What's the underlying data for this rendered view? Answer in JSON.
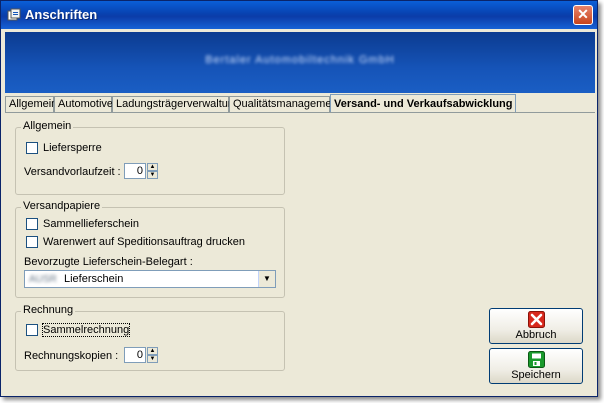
{
  "window": {
    "title": "Anschriften",
    "close_glyph": "✕"
  },
  "banner": {
    "company": "Bertaler Automobiltechnik GmbH"
  },
  "tabs": [
    {
      "label": "Allgemein",
      "active": false
    },
    {
      "label": "Automotive",
      "active": false
    },
    {
      "label": "Ladungsträgerverwaltung",
      "active": false
    },
    {
      "label": "Qualitätsmanagement",
      "active": false
    },
    {
      "label": "Versand- und Verkaufsabwicklung",
      "active": true
    }
  ],
  "allgemein": {
    "title": "Allgemein",
    "liefersperre": {
      "label": "Liefersperre",
      "checked": false
    },
    "versandvorlaufzeit": {
      "label": "Versandvorlaufzeit :",
      "value": "0"
    }
  },
  "versandpapiere": {
    "title": "Versandpapiere",
    "sammellieferschein": {
      "label": "Sammellieferschein",
      "checked": false
    },
    "warenwert": {
      "label": "Warenwert auf Speditionsauftrag drucken",
      "checked": false
    },
    "belegart": {
      "label": "Bevorzugte Lieferschein-Belegart :",
      "prefix": "AUSR",
      "value": "Lieferschein"
    }
  },
  "rechnung": {
    "title": "Rechnung",
    "sammelrechnung": {
      "label": "Sammelrechnung",
      "checked": false
    },
    "kopien": {
      "label": "Rechnungskopien :",
      "value": "0"
    }
  },
  "buttons": {
    "abbruch": {
      "label": "Abbruch"
    },
    "speichern": {
      "label": "Speichern"
    }
  },
  "colors": {
    "titlebar": "#0842b0",
    "banner": "#1654b8",
    "face": "#ece9d8",
    "cancel_icon": "#d8281c",
    "save_icon": "#1a9a2c"
  }
}
